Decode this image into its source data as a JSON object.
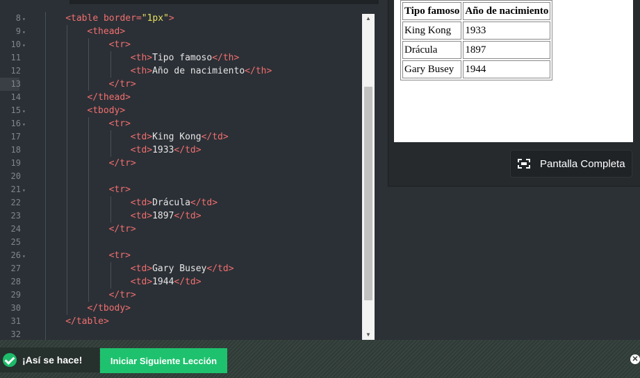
{
  "editor": {
    "lines": [
      {
        "num": "8",
        "fold": true,
        "indent": 1,
        "parts": [
          [
            "tag",
            "<table "
          ],
          [
            "attr",
            "border="
          ],
          [
            "val",
            "\"1px\""
          ],
          [
            "tag",
            ">"
          ]
        ]
      },
      {
        "num": "9",
        "fold": true,
        "indent": 2,
        "parts": [
          [
            "tag",
            "<thead>"
          ]
        ]
      },
      {
        "num": "10",
        "fold": true,
        "indent": 3,
        "parts": [
          [
            "tag",
            "<tr>"
          ]
        ]
      },
      {
        "num": "11",
        "fold": false,
        "indent": 4,
        "parts": [
          [
            "tag",
            "<th>"
          ],
          [
            "txt",
            "Tipo famoso"
          ],
          [
            "tag",
            "</th>"
          ]
        ]
      },
      {
        "num": "12",
        "fold": false,
        "indent": 4,
        "parts": [
          [
            "tag",
            "<th>"
          ],
          [
            "txt",
            "Año de nacimiento"
          ],
          [
            "tag",
            "</th>"
          ]
        ]
      },
      {
        "num": "13",
        "fold": false,
        "indent": 3,
        "parts": [
          [
            "tag",
            "</tr>"
          ]
        ]
      },
      {
        "num": "14",
        "fold": false,
        "indent": 2,
        "parts": [
          [
            "tag",
            "</thead>"
          ]
        ]
      },
      {
        "num": "15",
        "fold": true,
        "indent": 2,
        "parts": [
          [
            "tag",
            "<tbody>"
          ]
        ]
      },
      {
        "num": "16",
        "fold": true,
        "indent": 3,
        "parts": [
          [
            "tag",
            "<tr>"
          ]
        ]
      },
      {
        "num": "17",
        "fold": false,
        "indent": 4,
        "parts": [
          [
            "tag",
            "<td>"
          ],
          [
            "txt",
            "King Kong"
          ],
          [
            "tag",
            "</td>"
          ]
        ]
      },
      {
        "num": "18",
        "fold": false,
        "indent": 4,
        "parts": [
          [
            "tag",
            "<td>"
          ],
          [
            "txt",
            "1933"
          ],
          [
            "tag",
            "</td>"
          ]
        ]
      },
      {
        "num": "19",
        "fold": false,
        "indent": 3,
        "parts": [
          [
            "tag",
            "</tr>"
          ]
        ]
      },
      {
        "num": "20",
        "fold": false,
        "indent": 3,
        "parts": []
      },
      {
        "num": "21",
        "fold": true,
        "indent": 3,
        "parts": [
          [
            "tag",
            "<tr>"
          ]
        ]
      },
      {
        "num": "22",
        "fold": false,
        "indent": 4,
        "parts": [
          [
            "tag",
            "<td>"
          ],
          [
            "txt",
            "Drácula"
          ],
          [
            "tag",
            "</td>"
          ]
        ]
      },
      {
        "num": "23",
        "fold": false,
        "indent": 4,
        "parts": [
          [
            "tag",
            "<td>"
          ],
          [
            "txt",
            "1897"
          ],
          [
            "tag",
            "</td>"
          ]
        ]
      },
      {
        "num": "24",
        "fold": false,
        "indent": 3,
        "parts": [
          [
            "tag",
            "</tr>"
          ]
        ]
      },
      {
        "num": "25",
        "fold": false,
        "indent": 3,
        "parts": []
      },
      {
        "num": "26",
        "fold": true,
        "indent": 3,
        "parts": [
          [
            "tag",
            "<tr>"
          ]
        ]
      },
      {
        "num": "27",
        "fold": false,
        "indent": 4,
        "parts": [
          [
            "tag",
            "<td>"
          ],
          [
            "txt",
            "Gary Busey"
          ],
          [
            "tag",
            "</td>"
          ]
        ]
      },
      {
        "num": "28",
        "fold": false,
        "indent": 4,
        "parts": [
          [
            "tag",
            "<td>"
          ],
          [
            "txt",
            "1944"
          ],
          [
            "tag",
            "</td>"
          ]
        ]
      },
      {
        "num": "29",
        "fold": false,
        "indent": 3,
        "parts": [
          [
            "tag",
            "</tr>"
          ]
        ]
      },
      {
        "num": "30",
        "fold": false,
        "indent": 2,
        "parts": [
          [
            "tag",
            "</tbody>"
          ]
        ]
      },
      {
        "num": "31",
        "fold": false,
        "indent": 1,
        "parts": [
          [
            "tag",
            "</table>"
          ]
        ]
      },
      {
        "num": "32",
        "fold": false,
        "indent": 1,
        "parts": []
      }
    ],
    "colors": {
      "tag": "#f26f6f",
      "value": "#e8e060",
      "text": "#e6e6e6",
      "background": "#2b3036"
    }
  },
  "preview": {
    "headers": [
      "Tipo famoso",
      "Año de nacimiento"
    ],
    "rows": [
      [
        "King Kong",
        "1933"
      ],
      [
        "Drácula",
        "1897"
      ],
      [
        "Gary Busey",
        "1944"
      ]
    ],
    "fullscreen_label": "Pantalla Completa",
    "fullscreen_icon": "fullscreen-icon"
  },
  "footer": {
    "success_text": "¡Así se hace!",
    "next_lesson_label": "Iniciar Siguiente Lección",
    "accent": "#1ec26e",
    "close_icon": "close-icon"
  }
}
